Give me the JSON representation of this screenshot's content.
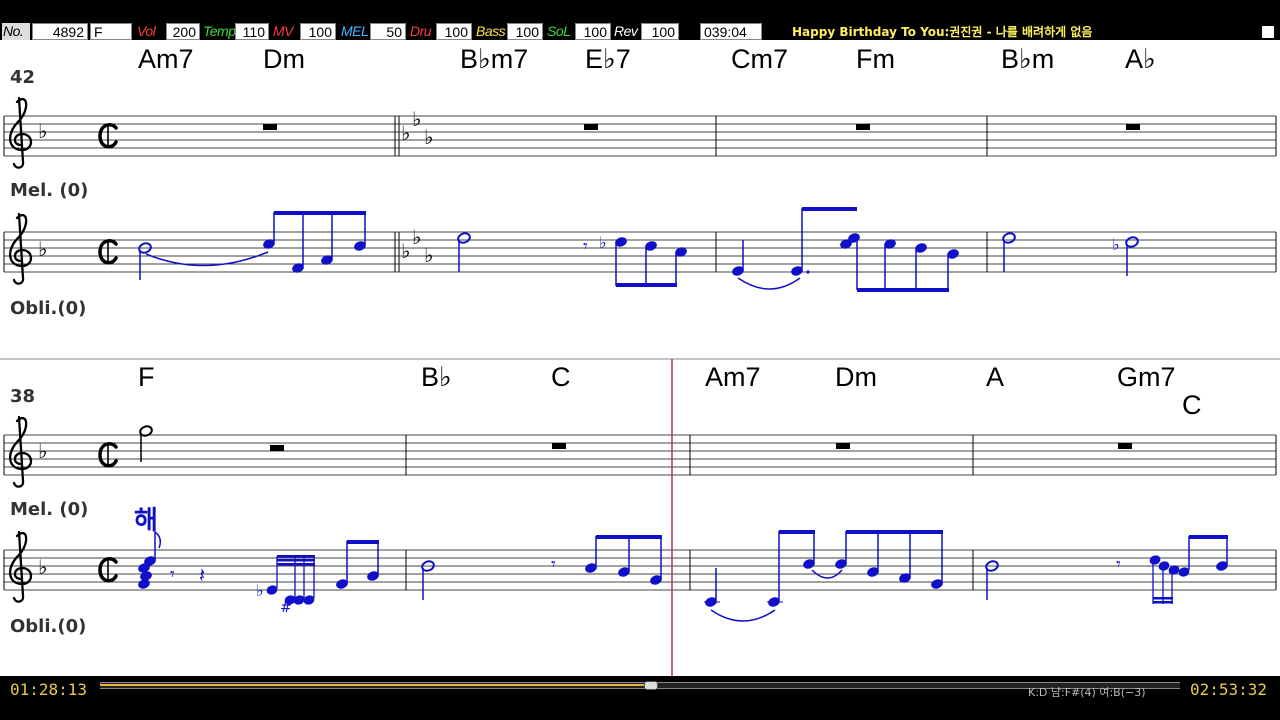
{
  "topbar": {
    "no_label": "No.",
    "no_value": "4892",
    "key_value": "F",
    "params": [
      {
        "label": "Vol",
        "value": "200",
        "color": "#ff3b3b"
      },
      {
        "label": "Temp",
        "value": "110",
        "color": "#3bdc3b"
      },
      {
        "label": "MV",
        "value": "100",
        "color": "#ff3b3b"
      },
      {
        "label": "MEL",
        "value": "50",
        "color": "#46b4ff"
      },
      {
        "label": "Dru",
        "value": "100",
        "color": "#ff3b3b"
      },
      {
        "label": "Bass",
        "value": "100",
        "color": "#ffe14a"
      },
      {
        "label": "SoL",
        "value": "100",
        "color": "#3bdc3b"
      },
      {
        "label": "Rev",
        "value": "100",
        "color": "#ffffff"
      }
    ],
    "elapsed": "039:04",
    "song_title": "Happy Birthday To You:권진권 - 나를 배려하게 없음"
  },
  "systems": [
    {
      "measure_number": "42",
      "top_staff_label": "Mel. (0)",
      "bottom_staff_label": "Obli.(0)",
      "chords": [
        "Am7",
        "Dm",
        "B♭m7",
        "E♭7",
        "Cm7",
        "Fm",
        "B♭m",
        "A♭"
      ]
    },
    {
      "measure_number": "38",
      "top_staff_label": "Mel. (0)",
      "bottom_staff_label": "Obli.(0)",
      "lyric": "해",
      "chords": [
        "F",
        "B♭",
        "C",
        "Am7",
        "Dm",
        "A",
        "Gm7",
        "C"
      ]
    }
  ],
  "bottombar": {
    "time_left": "01:28:13",
    "time_right": "02:53:32",
    "key_info": "K:D 남:F#(4) 여:B(−3)",
    "progress": 0.51
  },
  "colors": {
    "note_color": "#1010c8",
    "cursor_color": "#b0306a",
    "title_color": "#ffef5c",
    "time_color": "#e9c94a"
  }
}
